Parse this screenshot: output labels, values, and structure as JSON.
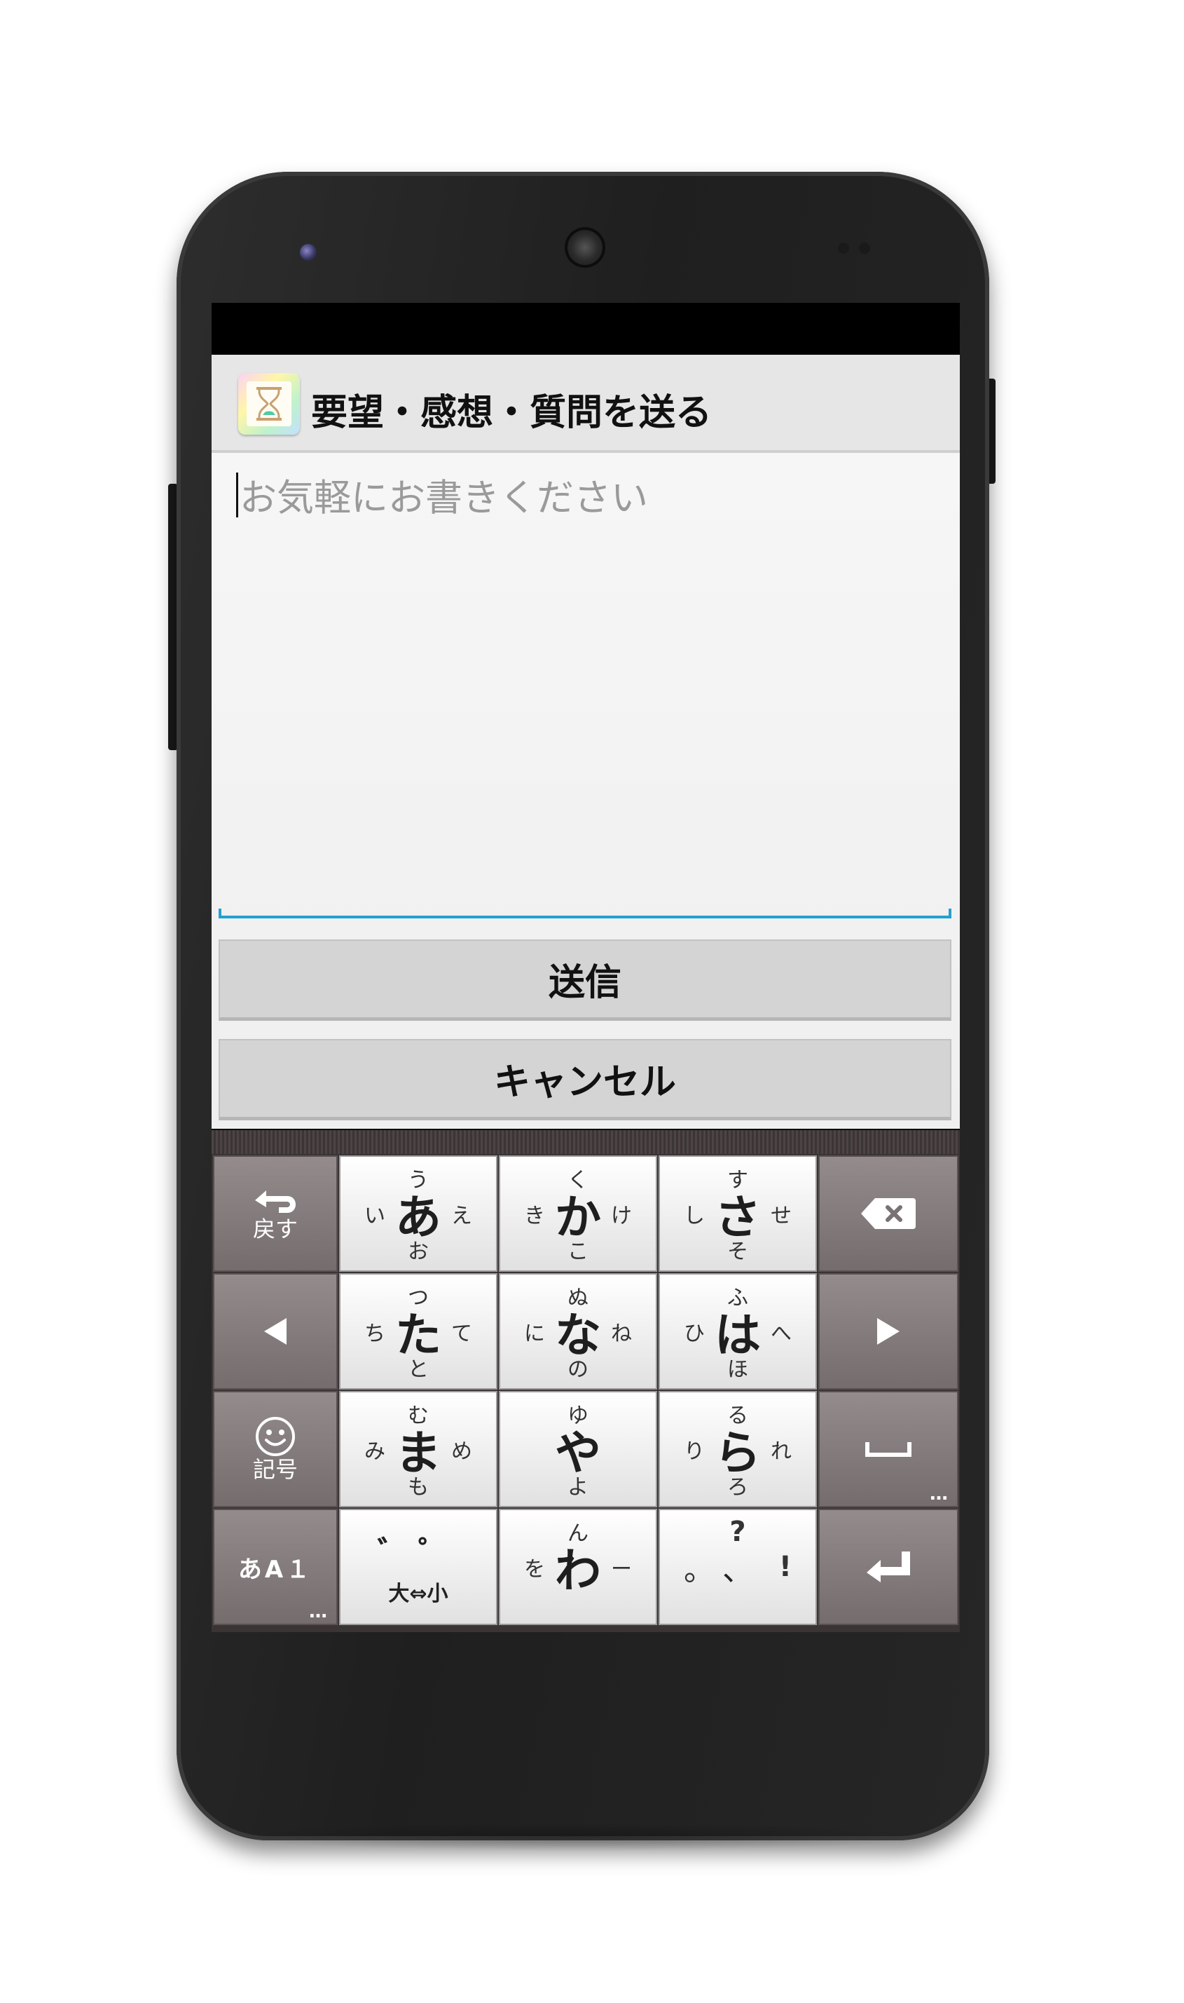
{
  "app": {
    "title": "要望・感想・質問を送る",
    "icon": "hourglass-icon"
  },
  "form": {
    "placeholder": "お気軽にお書きください",
    "send_label": "送信",
    "cancel_label": "キャンセル"
  },
  "keyboard": {
    "back_label": "戻す",
    "kigo_label": "記号",
    "mode_label": "あA１",
    "dots": "…",
    "keys": [
      {
        "main": "あ",
        "top": "う",
        "left": "い",
        "right": "え",
        "bottom": "お"
      },
      {
        "main": "か",
        "top": "く",
        "left": "き",
        "right": "け",
        "bottom": "こ"
      },
      {
        "main": "さ",
        "top": "す",
        "left": "し",
        "right": "せ",
        "bottom": "そ"
      },
      {
        "main": "た",
        "top": "つ",
        "left": "ち",
        "right": "て",
        "bottom": "と"
      },
      {
        "main": "な",
        "top": "ぬ",
        "left": "に",
        "right": "ね",
        "bottom": "の"
      },
      {
        "main": "は",
        "top": "ふ",
        "left": "ひ",
        "right": "へ",
        "bottom": "ほ"
      },
      {
        "main": "ま",
        "top": "む",
        "left": "み",
        "right": "め",
        "bottom": "も"
      },
      {
        "main": "や",
        "top": "ゆ",
        "left": "",
        "right": "",
        "bottom": "よ"
      },
      {
        "main": "ら",
        "top": "る",
        "left": "り",
        "right": "れ",
        "bottom": "ろ"
      }
    ],
    "dakuten": {
      "top": "゛゜",
      "bottom": "大⇔小"
    },
    "wa": {
      "main": "わ",
      "top": "ん",
      "left": "を",
      "right": "ー"
    },
    "punct": {
      "top": "?",
      "left": "。",
      "mid": "、",
      "right": "!"
    }
  },
  "colors": {
    "accent": "#24a0d0",
    "kb_dark": "#7e7676",
    "kb_light": "#f2f2f2",
    "button": "#d4d4d4"
  }
}
